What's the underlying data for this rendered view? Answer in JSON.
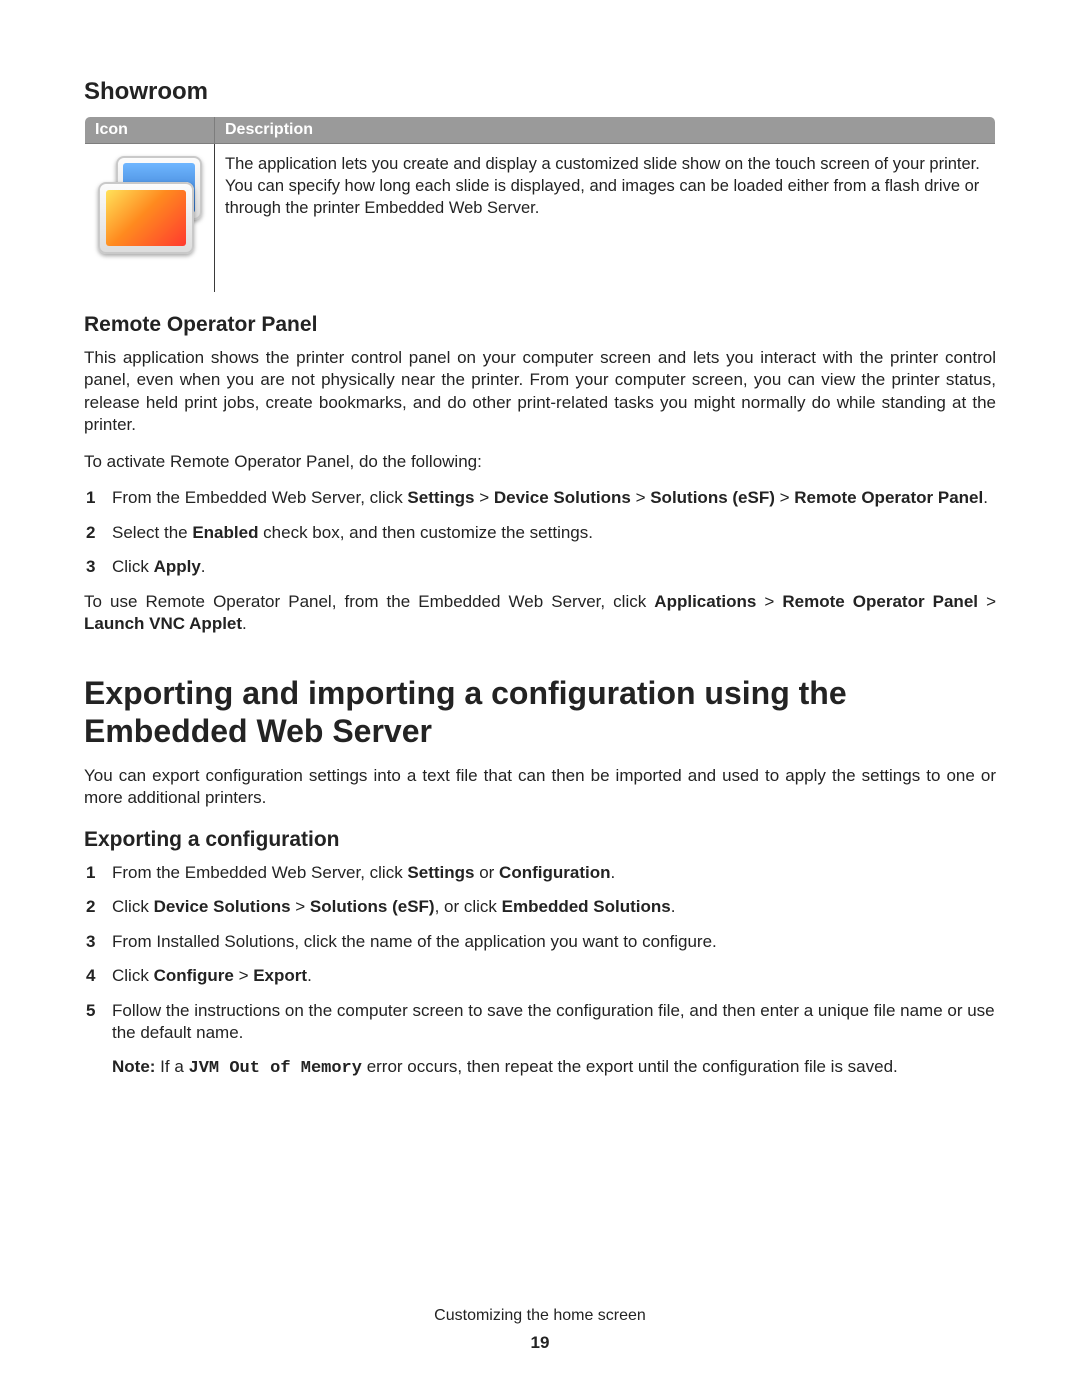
{
  "sections": {
    "showroom": {
      "heading": "Showroom",
      "table": {
        "col_icon": "Icon",
        "col_desc": "Description",
        "desc_text": "The application lets you create and display a customized slide show on the touch screen of your printer. You can specify how long each slide is displayed, and images can be loaded either from a flash drive or through the printer Embedded Web Server."
      }
    },
    "remote": {
      "heading": "Remote Operator Panel",
      "intro": "This application shows the printer control panel on your computer screen and lets you interact with the printer control panel, even when you are not physically near the printer. From your computer screen, you can view the printer status, release held print jobs, create bookmarks, and do other print-related tasks you might normally do while standing at the printer.",
      "activate_lead": "To activate Remote Operator Panel, do the following:",
      "steps": {
        "s1_pre": "From the Embedded Web Server, click ",
        "s1_b1": "Settings",
        "s1_gt1": " > ",
        "s1_b2": "Device Solutions",
        "s1_gt2": " > ",
        "s1_b3": "Solutions (eSF)",
        "s1_gt3": " > ",
        "s1_b4": "Remote Operator Panel",
        "s1_post": ".",
        "s2_pre": "Select the ",
        "s2_b": "Enabled",
        "s2_post": " check box, and then customize the settings.",
        "s3_pre": "Click ",
        "s3_b": "Apply",
        "s3_post": "."
      },
      "use_pre": "To use Remote Operator Panel, from the Embedded Web Server, click ",
      "use_b1": "Applications",
      "use_gt1": " > ",
      "use_b2": "Remote Operator Panel",
      "use_gt2": " > ",
      "use_b3": "Launch VNC Applet",
      "use_post": "."
    },
    "export": {
      "main_heading": "Exporting and importing a configuration using the Embedded Web Server",
      "intro": "You can export configuration settings into a text file that can then be imported and used to apply the settings to one or more additional printers.",
      "sub_heading": "Exporting a configuration",
      "steps": {
        "s1_pre": "From the Embedded Web Server, click ",
        "s1_b1": "Settings",
        "s1_mid": " or ",
        "s1_b2": "Configuration",
        "s1_post": ".",
        "s2_pre": "Click ",
        "s2_b1": "Device Solutions",
        "s2_gt": " > ",
        "s2_b2": "Solutions (eSF)",
        "s2_mid": ", or click ",
        "s2_b3": "Embedded Solutions",
        "s2_post": ".",
        "s3": "From Installed Solutions, click the name of the application you want to configure.",
        "s4_pre": "Click ",
        "s4_b1": "Configure",
        "s4_gt": " > ",
        "s4_b2": "Export",
        "s4_post": ".",
        "s5": "Follow the instructions on the computer screen to save the configuration file, and then enter a unique file name or use the default name.",
        "note_label": "Note: ",
        "note_pre": "If a ",
        "note_code": "JVM Out of Memory",
        "note_post": " error occurs, then repeat the export until the configuration file is saved."
      }
    }
  },
  "footer": {
    "title": "Customizing the home screen",
    "page": "19"
  }
}
